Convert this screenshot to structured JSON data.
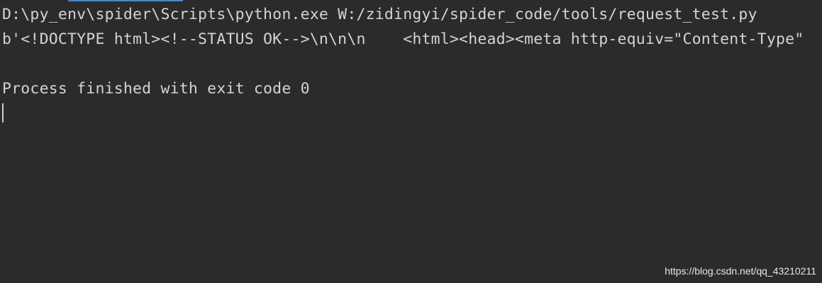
{
  "console": {
    "command_line": "D:\\py_env\\spider\\Scripts\\python.exe W:/zidingyi/spider_code/tools/request_test.py",
    "output_line": "b'<!DOCTYPE html><!--STATUS OK-->\\n\\n\\n    <html><head><meta http-equiv=\"Content-Type\"",
    "exit_message": "Process finished with exit code 0"
  },
  "watermark": "https://blog.csdn.net/qq_43210211",
  "colors": {
    "background": "#2b2b2b",
    "text": "#d4d4d4",
    "tab_accent": "#4a88c7"
  }
}
